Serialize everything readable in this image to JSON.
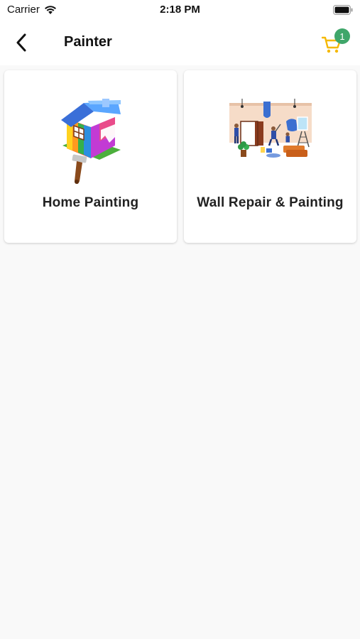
{
  "status_bar": {
    "carrier": "Carrier",
    "time": "2:18 PM"
  },
  "header": {
    "title": "Painter",
    "back_icon": "chevron-left-icon",
    "cart_icon": "shopping-cart-icon",
    "cart_count": "1"
  },
  "colors": {
    "cart": "#f5b800",
    "badge": "#3fa66a",
    "background": "#f9f9f9"
  },
  "services": [
    {
      "label": "Home Painting",
      "image": "painted-house-illustration"
    },
    {
      "label": "Wall Repair & Painting",
      "image": "wall-painting-workers-illustration"
    }
  ]
}
